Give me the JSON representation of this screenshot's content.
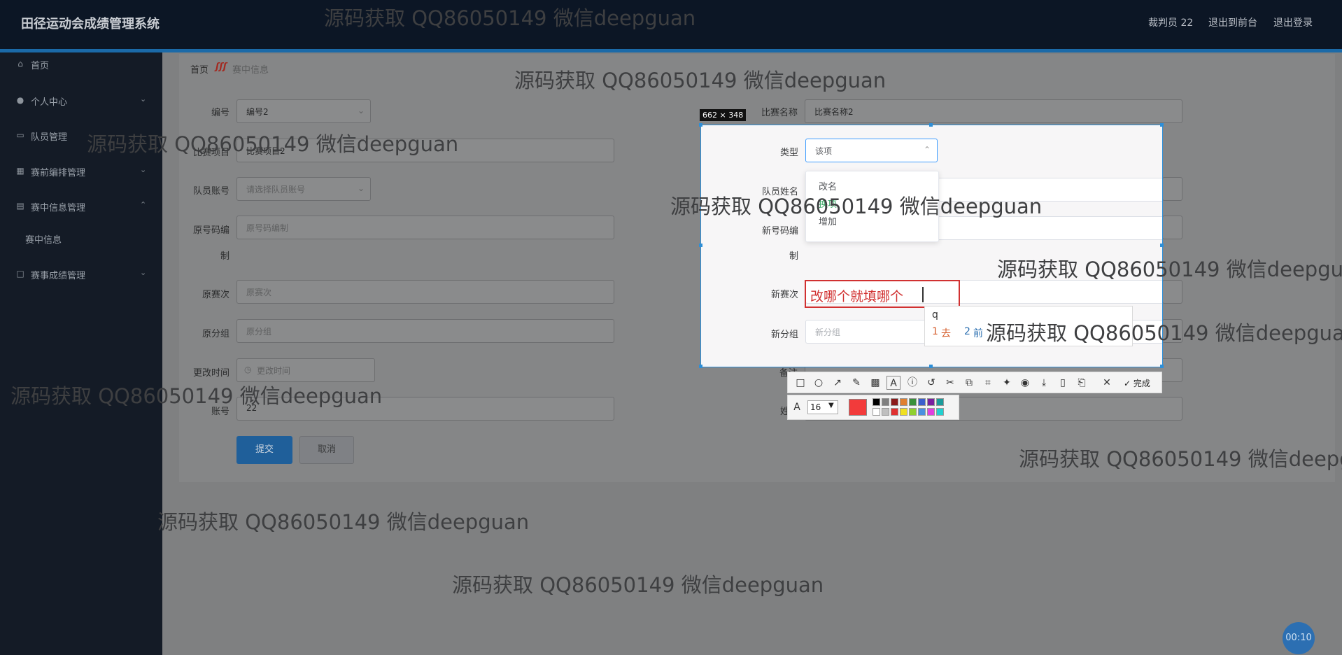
{
  "header": {
    "title": "田径运动会成绩管理系统",
    "user": "裁判员 22",
    "front_link": "退出到前台",
    "logout_link": "退出登录"
  },
  "sidebar": {
    "items": [
      {
        "label": "首页",
        "icon": "home-icon"
      },
      {
        "label": "个人中心",
        "icon": "user-icon"
      },
      {
        "label": "队员管理",
        "icon": "team-icon"
      },
      {
        "label": "赛前编排管理",
        "icon": "grid-icon"
      },
      {
        "label": "赛中信息管理",
        "icon": "bank-icon"
      },
      {
        "label": "赛中信息",
        "icon": ""
      },
      {
        "label": "赛事成绩管理",
        "icon": "board-icon"
      }
    ]
  },
  "breadcrumb": {
    "home": "首页",
    "current": "赛中信息"
  },
  "form": {
    "id_label": "编号",
    "id_value": "编号2",
    "match_name_label": "比赛名称",
    "match_name_value": "比赛名称2",
    "project_label": "比赛项目",
    "project_value": "比赛项目2",
    "type_label": "类型",
    "member_account_label": "队员账号",
    "member_account_placeholder": "请选择队员账号",
    "member_name_label": "队员姓名",
    "orig_code_label_1": "原号码编",
    "orig_code_label_2": "制",
    "orig_code_placeholder": "原号码编制",
    "new_code_label_1": "新号码编",
    "new_code_label_2": "制",
    "orig_round_label": "原赛次",
    "orig_round_placeholder": "原赛次",
    "new_round_label": "新赛次",
    "orig_group_label": "原分组",
    "orig_group_placeholder": "原分组",
    "new_group_label": "新分组",
    "new_group_placeholder": "新分组",
    "change_time_label": "更改时间",
    "change_time_placeholder": "更改时间",
    "remark_label": "备注",
    "account_label": "账号",
    "account_value": "22",
    "name_label_fragment": "姓",
    "submit": "提交",
    "cancel": "取消"
  },
  "capture": {
    "size": "662 × 348",
    "type_value": "该项",
    "options": [
      "改名",
      "换项",
      "增加"
    ],
    "annotation_text": "改哪个就填哪个",
    "ime_input": "q",
    "ime_candidates": [
      {
        "num": "1",
        "text": "去"
      },
      {
        "num": "2",
        "text": "前"
      }
    ],
    "done_label": "完成",
    "font_size": "16",
    "selected_color": "#f23b3b",
    "palette": [
      "#000000",
      "#7f7f7f",
      "#8b1a1a",
      "#e08030",
      "#3a8f3a",
      "#3a5fcd",
      "#7a1fa0",
      "#1a9a9a",
      "#ffffff",
      "#bfbfbf",
      "#e03030",
      "#f0e020",
      "#90d030",
      "#4a90e0",
      "#e040e0",
      "#20d0d0"
    ]
  },
  "watermark": "源码获取 QQ86050149 微信deepguan",
  "timer": "00:10"
}
